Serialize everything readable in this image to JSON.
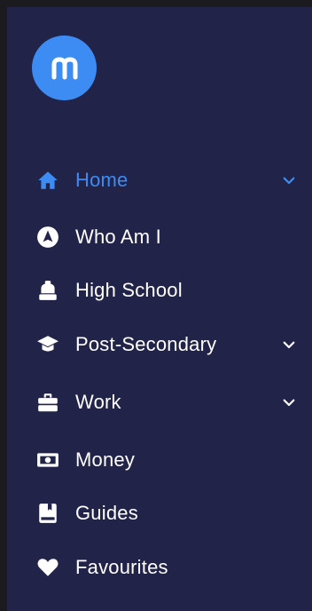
{
  "brand": {
    "logo_icon": "mydestiny-logo-icon",
    "logo_color": "#3d8cf3"
  },
  "colors": {
    "background": "#222349",
    "active": "#3d8cf3",
    "text": "#ffffff"
  },
  "nav": {
    "items": [
      {
        "label": "Home",
        "icon": "home-icon",
        "active": true,
        "expandable": true
      },
      {
        "label": "Who Am I",
        "icon": "compass-icon",
        "active": false,
        "expandable": false
      },
      {
        "label": "High School",
        "icon": "backpack-icon",
        "active": false,
        "expandable": false
      },
      {
        "label": "Post-Secondary",
        "icon": "graduation-cap-icon",
        "active": false,
        "expandable": true
      },
      {
        "label": "Work",
        "icon": "briefcase-icon",
        "active": false,
        "expandable": true
      },
      {
        "label": "Money",
        "icon": "money-icon",
        "active": false,
        "expandable": false
      },
      {
        "label": "Guides",
        "icon": "book-icon",
        "active": false,
        "expandable": false
      },
      {
        "label": "Favourites",
        "icon": "heart-icon",
        "active": false,
        "expandable": false
      }
    ]
  }
}
